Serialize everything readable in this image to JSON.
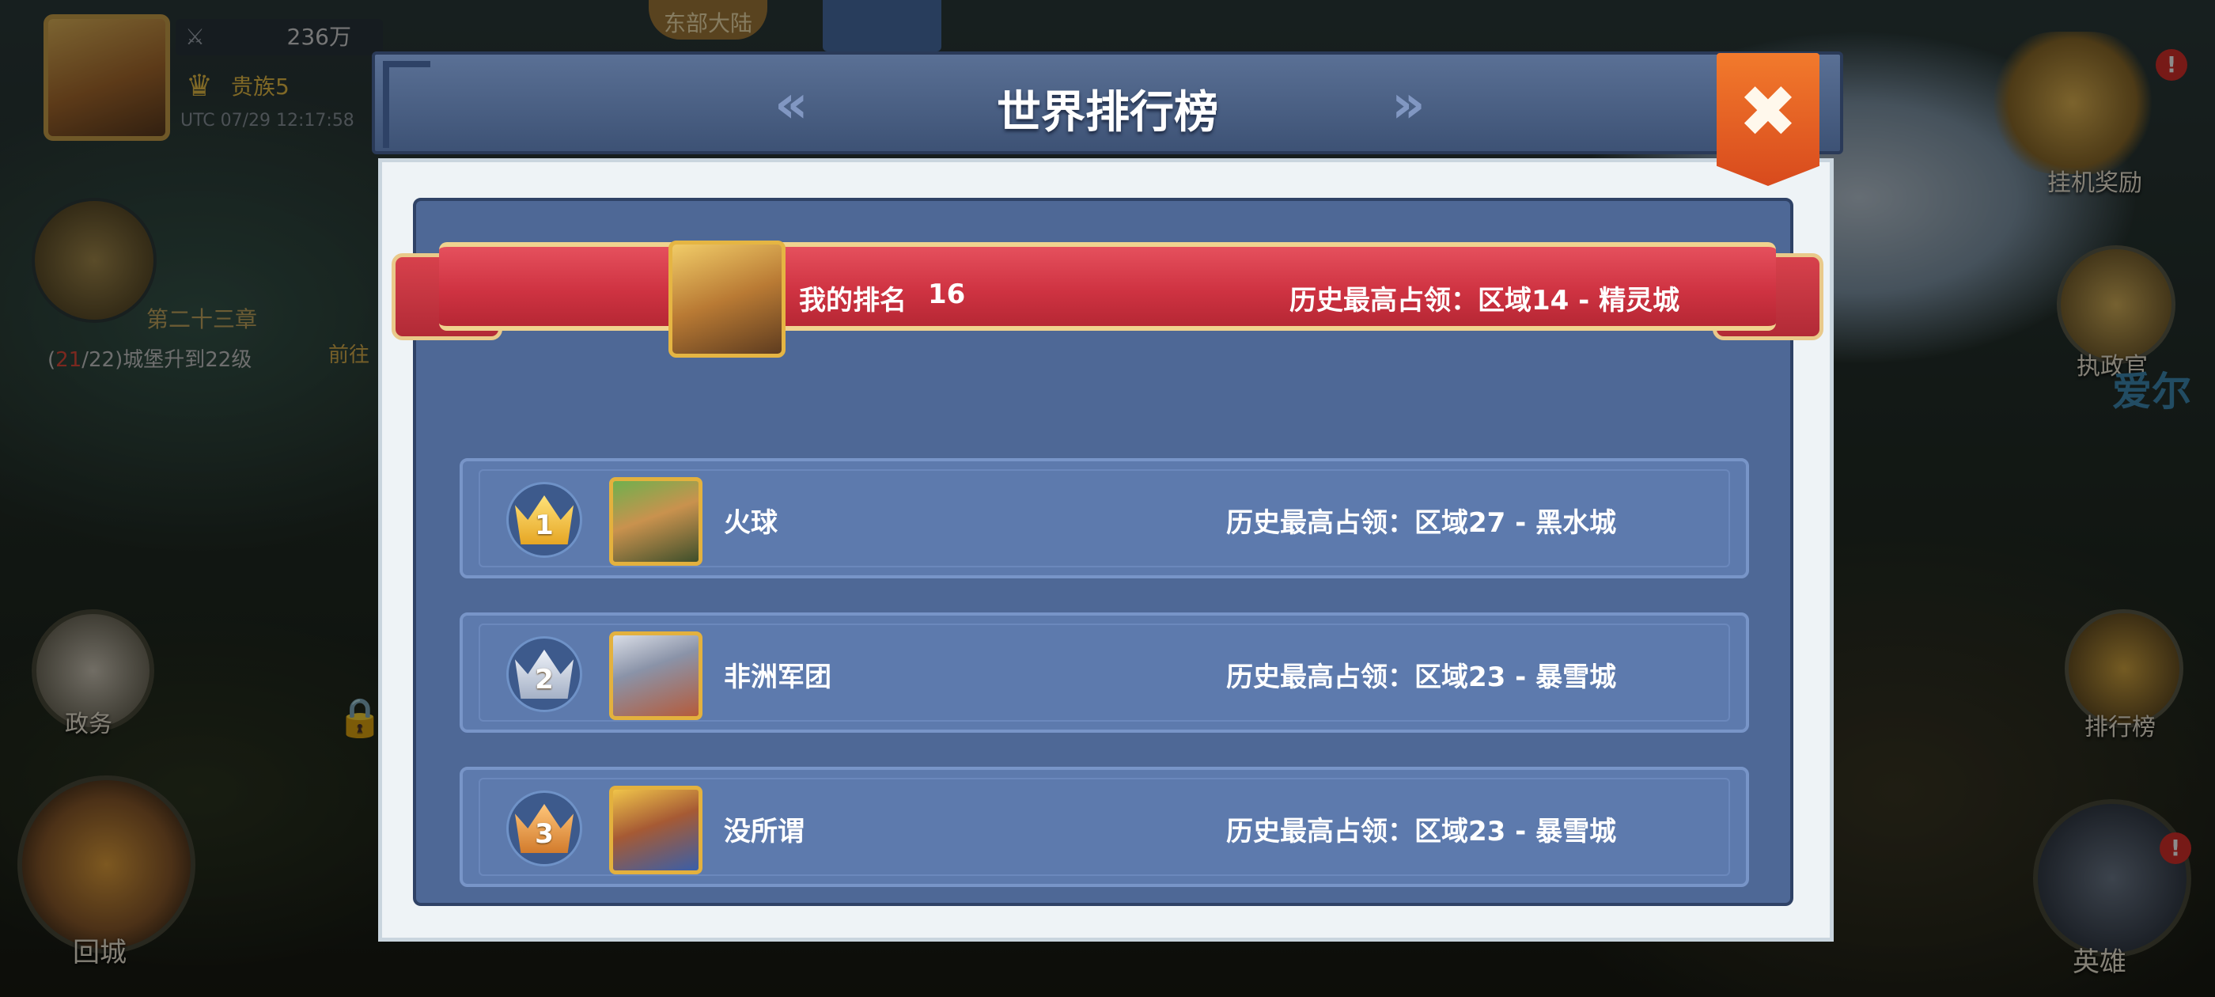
{
  "hud": {
    "power": "236万",
    "noble": "贵族5",
    "utc": "UTC 07/29 12:17:58",
    "top_tab": "东部大陆",
    "chapter": "第二十三章",
    "quest_prefix": "(",
    "quest_progress": "21",
    "quest_suffix": "/22)城堡升到22级",
    "quest_goto": "前往",
    "left_btn_politics": "政务",
    "left_btn_return": "回城",
    "right_btn_idle": "挂机奖励",
    "right_btn_consul": "执政官",
    "right_btn_ranking": "排行榜",
    "right_btn_hero": "英雄",
    "map_label": "爱尔",
    "badge": "!"
  },
  "dialog": {
    "title": "世界排行榜",
    "prev_icon": "«",
    "next_icon": "»",
    "close_icon": "✖",
    "my_rank": {
      "label": "我的排名",
      "value": "16",
      "history": "历史最高占领：区域14 - 精灵城"
    },
    "rows": [
      {
        "rank": "1",
        "name": "火球",
        "history": "历史最高占领：区域27 - 黑水城",
        "crown": "gold"
      },
      {
        "rank": "2",
        "name": "非洲军团",
        "history": "历史最高占领：区域23 - 暴雪城",
        "crown": "silver"
      },
      {
        "rank": "3",
        "name": "没所谓",
        "history": "历史最高占领：区域23 - 暴雪城",
        "crown": "bronze"
      }
    ]
  },
  "colors": {
    "panel": "#4e6896",
    "row": "#5d7aad",
    "ribbon": "#cf3342",
    "close": "#e35a22",
    "gold": "#e3b13e"
  }
}
